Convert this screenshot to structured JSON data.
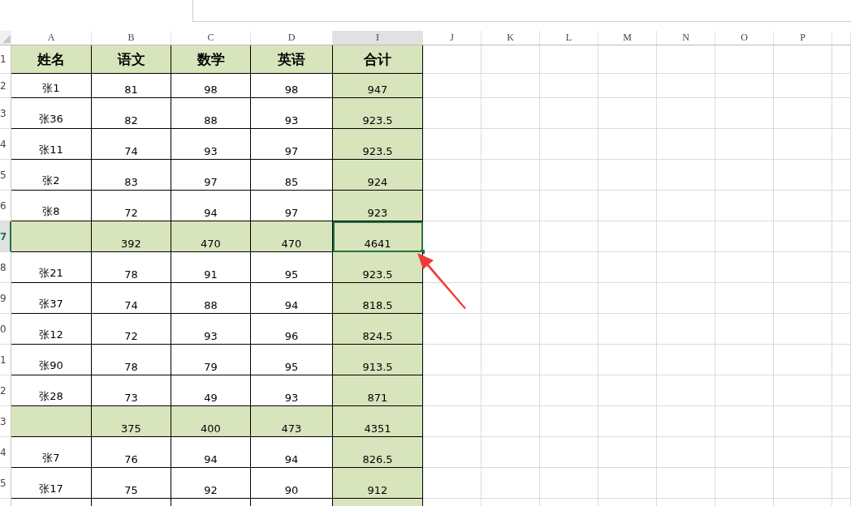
{
  "column_headers": [
    {
      "label": "A",
      "selected": false,
      "shaded": false
    },
    {
      "label": "B",
      "selected": false,
      "shaded": false
    },
    {
      "label": "C",
      "selected": false,
      "shaded": false
    },
    {
      "label": "D",
      "selected": false,
      "shaded": false
    },
    {
      "label": "I",
      "selected": true,
      "shaded": true
    },
    {
      "label": "J",
      "selected": false,
      "shaded": false
    },
    {
      "label": "K",
      "selected": false,
      "shaded": false
    },
    {
      "label": "L",
      "selected": false,
      "shaded": false
    },
    {
      "label": "M",
      "selected": false,
      "shaded": false
    },
    {
      "label": "N",
      "selected": false,
      "shaded": false
    },
    {
      "label": "O",
      "selected": false,
      "shaded": false
    },
    {
      "label": "P",
      "selected": false,
      "shaded": false
    }
  ],
  "rows": [
    {
      "number": "1",
      "kind": "header",
      "selected": false,
      "cells": [
        "姓名",
        "语文",
        "数学",
        "英语",
        "合计"
      ]
    },
    {
      "number": "2",
      "kind": "data",
      "selected": false,
      "cells": [
        "张1",
        "81",
        "98",
        "98",
        "947"
      ]
    },
    {
      "number": "3",
      "kind": "data",
      "selected": false,
      "cells": [
        "张36",
        "82",
        "88",
        "93",
        "923.5"
      ]
    },
    {
      "number": "4",
      "kind": "data",
      "selected": false,
      "cells": [
        "张11",
        "74",
        "93",
        "97",
        "923.5"
      ]
    },
    {
      "number": "5",
      "kind": "data",
      "selected": false,
      "cells": [
        "张2",
        "83",
        "97",
        "85",
        "924"
      ]
    },
    {
      "number": "6",
      "kind": "data",
      "selected": false,
      "cells": [
        "张8",
        "72",
        "94",
        "97",
        "923"
      ]
    },
    {
      "number": "7",
      "kind": "subtotal",
      "selected": true,
      "cells": [
        null,
        "392",
        "470",
        "470",
        "4641"
      ]
    },
    {
      "number": "8",
      "kind": "data",
      "selected": false,
      "cells": [
        "张21",
        "78",
        "91",
        "95",
        "923.5"
      ]
    },
    {
      "number": "9",
      "kind": "data",
      "selected": false,
      "cells": [
        "张37",
        "74",
        "88",
        "94",
        "818.5"
      ]
    },
    {
      "number": "0",
      "kind": "data",
      "selected": false,
      "cells": [
        "张12",
        "72",
        "93",
        "96",
        "824.5"
      ]
    },
    {
      "number": "1",
      "kind": "data",
      "selected": false,
      "cells": [
        "张90",
        "78",
        "79",
        "95",
        "913.5"
      ]
    },
    {
      "number": "2",
      "kind": "data",
      "selected": false,
      "cells": [
        "张28",
        "73",
        "49",
        "93",
        "871"
      ]
    },
    {
      "number": "3",
      "kind": "subtotal",
      "selected": false,
      "cells": [
        null,
        "375",
        "400",
        "473",
        "4351"
      ]
    },
    {
      "number": "4",
      "kind": "data",
      "selected": false,
      "cells": [
        "张7",
        "76",
        "94",
        "94",
        "826.5"
      ]
    },
    {
      "number": "5",
      "kind": "data",
      "selected": false,
      "cells": [
        "张17",
        "75",
        "92",
        "90",
        "912"
      ]
    }
  ]
}
